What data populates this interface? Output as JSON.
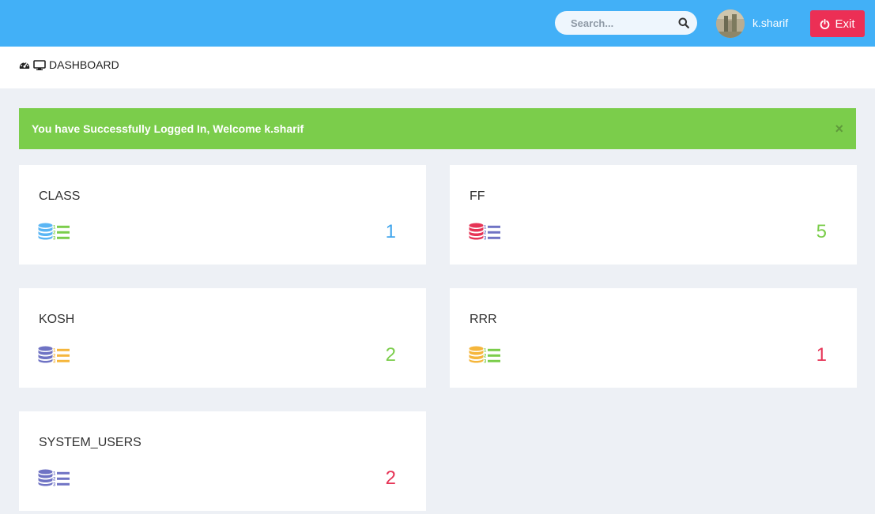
{
  "header": {
    "search_placeholder": "Search...",
    "username": "k.sharif",
    "exit_label": "Exit"
  },
  "breadcrumb": {
    "label": "DASHBOARD"
  },
  "alert": {
    "message": "You have Successfully Logged In, Welcome k.sharif",
    "close_glyph": "×"
  },
  "cards": [
    {
      "title": "CLASS",
      "count": "1",
      "db_color": "#5bb6f4",
      "list_color": "#7bcd4b",
      "count_color": "#42a6ec"
    },
    {
      "title": "FF",
      "count": "5",
      "db_color": "#e63456",
      "list_color": "#6f73c4",
      "count_color": "#7bcd4b"
    },
    {
      "title": "KOSH",
      "count": "2",
      "db_color": "#6f73c4",
      "list_color": "#f5b63c",
      "count_color": "#7bcd4b"
    },
    {
      "title": "RRR",
      "count": "1",
      "db_color": "#f5b63c",
      "list_color": "#7bcd4b",
      "count_color": "#e63456"
    },
    {
      "title": "SYSTEM_USERS",
      "count": "2",
      "db_color": "#6f73c4",
      "list_color": "#6f73c4",
      "count_color": "#e63456"
    }
  ],
  "icons": {
    "search": "search-icon",
    "exit": "power-icon",
    "breadcrumb": [
      "tachometer-icon",
      "desktop-icon"
    ],
    "card": [
      "database-icon",
      "ordered-list-icon"
    ]
  },
  "colors": {
    "topbar": "#42b0f7",
    "alert": "#7bcd4b",
    "exit": "#ec2f55",
    "page_bg": "#edf0f5"
  }
}
